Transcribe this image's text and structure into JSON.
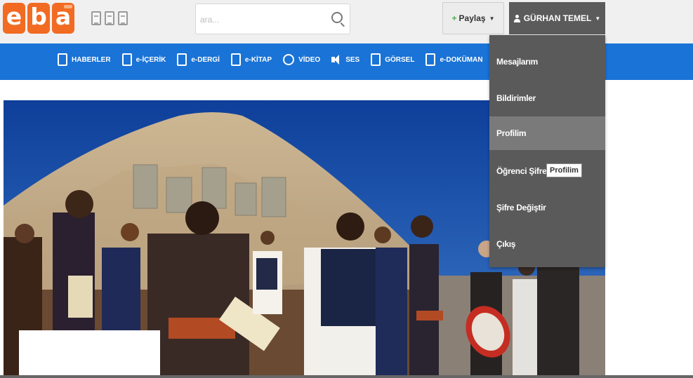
{
  "brand": {
    "letters": [
      "e",
      "b",
      "a"
    ],
    "color": "#f26b22"
  },
  "header": {
    "search": {
      "placeholder": "ara..."
    },
    "share_label": "Paylaş",
    "user_name": "GÜRHAN TEMEL"
  },
  "nav": {
    "color": "#1a73d6",
    "items": [
      {
        "label": "HABERLER",
        "icon": "news-icon"
      },
      {
        "label": "e-İÇERİK",
        "icon": "content-icon"
      },
      {
        "label": "e-DERGİ",
        "icon": "magazine-icon"
      },
      {
        "label": "e-KİTAP",
        "icon": "book-icon"
      },
      {
        "label": "VİDEO",
        "icon": "video-icon"
      },
      {
        "label": "SES",
        "icon": "speaker-icon"
      },
      {
        "label": "GÖRSEL",
        "icon": "image-icon"
      },
      {
        "label": "e-DOKÜMAN",
        "icon": "document-icon"
      }
    ]
  },
  "user_menu": {
    "items": [
      {
        "label": "Mesajlarım"
      },
      {
        "label": "Bildirimler"
      },
      {
        "label": "Profilim"
      },
      {
        "label": "Öğrenci Şifre"
      },
      {
        "label": "Şifre Değiştir"
      },
      {
        "label": "Çıkış"
      }
    ],
    "highlighted": "Profilim",
    "tooltip": "Profilim"
  }
}
